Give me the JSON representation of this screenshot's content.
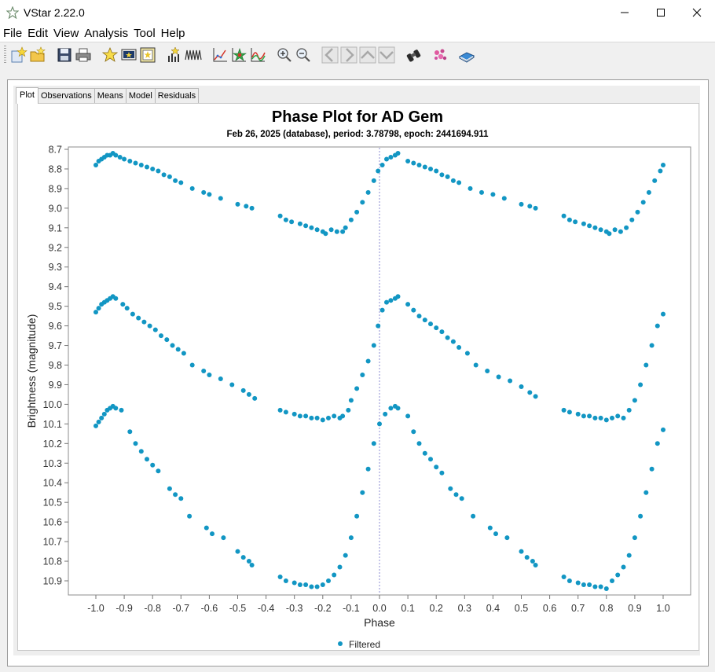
{
  "window": {
    "title": "VStar 2.22.0",
    "controls": [
      "minimize-icon",
      "maximize-icon",
      "close-icon"
    ]
  },
  "menu": {
    "items": [
      "File",
      "Edit",
      "View",
      "Analysis",
      "Tool",
      "Help"
    ]
  },
  "toolbar": {
    "icons": [
      "new-star-icon",
      "open-file-icon",
      "save-icon",
      "print-icon",
      "star-info-icon",
      "photometry-icon",
      "observation-details-icon",
      "period-analysis-icon",
      "wavelet-icon",
      "filter-plot-icon",
      "model-icon",
      "polynomial-fit-icon",
      "zoom-in-icon",
      "zoom-out-icon",
      "pan-left-icon",
      "pan-right-icon",
      "pan-up-icon",
      "pan-down-icon",
      "binoculars-icon",
      "plugin-icon",
      "help-book-icon"
    ]
  },
  "tabs": [
    {
      "label": "Plot",
      "active": true
    },
    {
      "label": "Observations",
      "active": false
    },
    {
      "label": "Means",
      "active": false
    },
    {
      "label": "Model",
      "active": false
    },
    {
      "label": "Residuals",
      "active": false
    }
  ],
  "colors": {
    "series": "#1296c3",
    "accent": "#0078d7"
  },
  "chart_data": {
    "type": "scatter",
    "title": "Phase Plot for AD Gem",
    "subtitle": "Feb 26, 2025 (database), period: 3.78798, epoch: 2441694.911",
    "xlabel": "Phase",
    "ylabel": "Brightness (magnitude)",
    "xlim": [
      -1.05,
      1.05
    ],
    "ylim": [
      8.7,
      10.95
    ],
    "y_inverted": true,
    "xticks": [
      "-1.0",
      "-0.9",
      "-0.8",
      "-0.7",
      "-0.6",
      "-0.5",
      "-0.4",
      "-0.3",
      "-0.2",
      "-0.1",
      "0.0",
      "0.1",
      "0.2",
      "0.3",
      "0.4",
      "0.5",
      "0.6",
      "0.7",
      "0.8",
      "0.9",
      "1.0"
    ],
    "yticks": [
      "8.7",
      "8.8",
      "8.9",
      "9.0",
      "9.1",
      "9.2",
      "9.3",
      "9.4",
      "9.5",
      "9.6",
      "9.7",
      "9.8",
      "9.9",
      "10.0",
      "10.1",
      "10.2",
      "10.3",
      "10.4",
      "10.5",
      "10.6",
      "10.7",
      "10.8",
      "10.9"
    ],
    "zero_line_x": 0.0,
    "legend": {
      "placement": "bottom-center",
      "entries": [
        "Filtered"
      ]
    },
    "series": [
      {
        "name": "Filtered",
        "points": [
          [
            -1.0,
            8.78
          ],
          [
            -0.99,
            8.76
          ],
          [
            -0.98,
            8.75
          ],
          [
            -0.97,
            8.74
          ],
          [
            -0.96,
            8.73
          ],
          [
            -0.95,
            8.73
          ],
          [
            -0.94,
            8.72
          ],
          [
            -0.93,
            8.73
          ],
          [
            -0.915,
            8.74
          ],
          [
            -0.9,
            8.75
          ],
          [
            -0.88,
            8.76
          ],
          [
            -0.86,
            8.77
          ],
          [
            -0.84,
            8.78
          ],
          [
            -0.82,
            8.79
          ],
          [
            -0.8,
            8.8
          ],
          [
            -0.78,
            8.81
          ],
          [
            -0.76,
            8.83
          ],
          [
            -0.74,
            8.84
          ],
          [
            -0.72,
            8.86
          ],
          [
            -0.7,
            8.87
          ],
          [
            -0.66,
            8.9
          ],
          [
            -0.62,
            8.92
          ],
          [
            -0.6,
            8.93
          ],
          [
            -0.56,
            8.95
          ],
          [
            -0.5,
            8.98
          ],
          [
            -0.47,
            8.99
          ],
          [
            -0.45,
            9.0
          ],
          [
            -0.35,
            9.04
          ],
          [
            -0.33,
            9.06
          ],
          [
            -0.31,
            9.07
          ],
          [
            -0.28,
            9.08
          ],
          [
            -0.26,
            9.09
          ],
          [
            -0.24,
            9.1
          ],
          [
            -0.22,
            9.11
          ],
          [
            -0.2,
            9.12
          ],
          [
            -0.19,
            9.13
          ],
          [
            -0.17,
            9.11
          ],
          [
            -0.15,
            9.12
          ],
          [
            -0.13,
            9.12
          ],
          [
            -0.12,
            9.1
          ],
          [
            -0.1,
            9.06
          ],
          [
            -0.08,
            9.02
          ],
          [
            -0.06,
            8.97
          ],
          [
            -0.04,
            8.92
          ],
          [
            -0.02,
            8.86
          ],
          [
            -0.005,
            8.81
          ],
          [
            0.01,
            8.78
          ],
          [
            0.025,
            8.75
          ],
          [
            0.04,
            8.74
          ],
          [
            0.055,
            8.73
          ],
          [
            0.065,
            8.72
          ],
          [
            0.1,
            8.76
          ],
          [
            0.12,
            8.77
          ],
          [
            0.14,
            8.78
          ],
          [
            0.16,
            8.79
          ],
          [
            0.18,
            8.8
          ],
          [
            0.2,
            8.81
          ],
          [
            0.22,
            8.83
          ],
          [
            0.24,
            8.84
          ],
          [
            0.26,
            8.86
          ],
          [
            0.28,
            8.87
          ],
          [
            0.32,
            8.9
          ],
          [
            0.36,
            8.92
          ],
          [
            0.4,
            8.93
          ],
          [
            0.44,
            8.95
          ],
          [
            0.5,
            8.98
          ],
          [
            0.53,
            8.99
          ],
          [
            0.55,
            9.0
          ],
          [
            0.65,
            9.04
          ],
          [
            0.67,
            9.06
          ],
          [
            0.69,
            9.07
          ],
          [
            0.72,
            9.08
          ],
          [
            0.74,
            9.09
          ],
          [
            0.76,
            9.1
          ],
          [
            0.78,
            9.11
          ],
          [
            0.8,
            9.12
          ],
          [
            0.81,
            9.13
          ],
          [
            0.83,
            9.11
          ],
          [
            0.85,
            9.12
          ],
          [
            0.87,
            9.1
          ],
          [
            0.89,
            9.06
          ],
          [
            0.91,
            9.02
          ],
          [
            0.93,
            8.97
          ],
          [
            0.95,
            8.92
          ],
          [
            0.97,
            8.86
          ],
          [
            0.99,
            8.81
          ],
          [
            1.0,
            8.78
          ],
          [
            -1.0,
            9.53
          ],
          [
            -0.99,
            9.51
          ],
          [
            -0.98,
            9.49
          ],
          [
            -0.97,
            9.48
          ],
          [
            -0.96,
            9.47
          ],
          [
            -0.95,
            9.46
          ],
          [
            -0.94,
            9.45
          ],
          [
            -0.93,
            9.46
          ],
          [
            -0.905,
            9.49
          ],
          [
            -0.89,
            9.51
          ],
          [
            -0.87,
            9.54
          ],
          [
            -0.85,
            9.56
          ],
          [
            -0.83,
            9.58
          ],
          [
            -0.81,
            9.6
          ],
          [
            -0.79,
            9.62
          ],
          [
            -0.77,
            9.65
          ],
          [
            -0.75,
            9.67
          ],
          [
            -0.73,
            9.7
          ],
          [
            -0.71,
            9.72
          ],
          [
            -0.69,
            9.74
          ],
          [
            -0.66,
            9.8
          ],
          [
            -0.62,
            9.83
          ],
          [
            -0.6,
            9.85
          ],
          [
            -0.56,
            9.87
          ],
          [
            -0.52,
            9.9
          ],
          [
            -0.48,
            9.93
          ],
          [
            -0.46,
            9.95
          ],
          [
            -0.44,
            9.97
          ],
          [
            -0.35,
            10.03
          ],
          [
            -0.33,
            10.04
          ],
          [
            -0.3,
            10.05
          ],
          [
            -0.28,
            10.06
          ],
          [
            -0.26,
            10.06
          ],
          [
            -0.24,
            10.07
          ],
          [
            -0.22,
            10.07
          ],
          [
            -0.2,
            10.08
          ],
          [
            -0.18,
            10.07
          ],
          [
            -0.16,
            10.06
          ],
          [
            -0.14,
            10.07
          ],
          [
            -0.13,
            10.06
          ],
          [
            -0.11,
            10.03
          ],
          [
            -0.1,
            9.98
          ],
          [
            -0.08,
            9.92
          ],
          [
            -0.06,
            9.85
          ],
          [
            -0.04,
            9.78
          ],
          [
            -0.02,
            9.7
          ],
          [
            -0.005,
            9.6
          ],
          [
            0.01,
            9.52
          ],
          [
            0.025,
            9.48
          ],
          [
            0.04,
            9.47
          ],
          [
            0.055,
            9.46
          ],
          [
            0.065,
            9.45
          ],
          [
            0.1,
            9.49
          ],
          [
            0.12,
            9.52
          ],
          [
            0.14,
            9.55
          ],
          [
            0.16,
            9.57
          ],
          [
            0.18,
            9.59
          ],
          [
            0.2,
            9.61
          ],
          [
            0.22,
            9.63
          ],
          [
            0.24,
            9.66
          ],
          [
            0.26,
            9.68
          ],
          [
            0.28,
            9.71
          ],
          [
            0.31,
            9.74
          ],
          [
            0.34,
            9.8
          ],
          [
            0.38,
            9.83
          ],
          [
            0.42,
            9.86
          ],
          [
            0.46,
            9.88
          ],
          [
            0.5,
            9.91
          ],
          [
            0.53,
            9.94
          ],
          [
            0.55,
            9.96
          ],
          [
            0.65,
            10.03
          ],
          [
            0.67,
            10.04
          ],
          [
            0.7,
            10.05
          ],
          [
            0.72,
            10.06
          ],
          [
            0.74,
            10.06
          ],
          [
            0.76,
            10.07
          ],
          [
            0.78,
            10.07
          ],
          [
            0.8,
            10.08
          ],
          [
            0.82,
            10.07
          ],
          [
            0.84,
            10.06
          ],
          [
            0.86,
            10.07
          ],
          [
            0.88,
            10.03
          ],
          [
            0.9,
            9.98
          ],
          [
            0.92,
            9.9
          ],
          [
            0.94,
            9.8
          ],
          [
            0.96,
            9.7
          ],
          [
            0.98,
            9.6
          ],
          [
            1.0,
            9.54
          ],
          [
            -1.0,
            10.11
          ],
          [
            -0.99,
            10.09
          ],
          [
            -0.98,
            10.07
          ],
          [
            -0.97,
            10.05
          ],
          [
            -0.96,
            10.03
          ],
          [
            -0.95,
            10.02
          ],
          [
            -0.94,
            10.01
          ],
          [
            -0.93,
            10.02
          ],
          [
            -0.91,
            10.03
          ],
          [
            -0.88,
            10.14
          ],
          [
            -0.86,
            10.2
          ],
          [
            -0.84,
            10.24
          ],
          [
            -0.82,
            10.28
          ],
          [
            -0.8,
            10.31
          ],
          [
            -0.78,
            10.34
          ],
          [
            -0.74,
            10.43
          ],
          [
            -0.72,
            10.46
          ],
          [
            -0.7,
            10.48
          ],
          [
            -0.67,
            10.57
          ],
          [
            -0.61,
            10.63
          ],
          [
            -0.59,
            10.66
          ],
          [
            -0.55,
            10.68
          ],
          [
            -0.5,
            10.75
          ],
          [
            -0.48,
            10.78
          ],
          [
            -0.46,
            10.8
          ],
          [
            -0.45,
            10.82
          ],
          [
            -0.35,
            10.88
          ],
          [
            -0.33,
            10.9
          ],
          [
            -0.3,
            10.91
          ],
          [
            -0.28,
            10.92
          ],
          [
            -0.26,
            10.92
          ],
          [
            -0.24,
            10.93
          ],
          [
            -0.22,
            10.93
          ],
          [
            -0.2,
            10.92
          ],
          [
            -0.18,
            10.9
          ],
          [
            -0.16,
            10.87
          ],
          [
            -0.14,
            10.83
          ],
          [
            -0.12,
            10.77
          ],
          [
            -0.1,
            10.68
          ],
          [
            -0.08,
            10.57
          ],
          [
            -0.06,
            10.45
          ],
          [
            -0.04,
            10.33
          ],
          [
            -0.02,
            10.2
          ],
          [
            0.0,
            10.1
          ],
          [
            0.02,
            10.05
          ],
          [
            0.04,
            10.02
          ],
          [
            0.055,
            10.01
          ],
          [
            0.065,
            10.02
          ],
          [
            0.1,
            10.06
          ],
          [
            0.12,
            10.14
          ],
          [
            0.14,
            10.2
          ],
          [
            0.16,
            10.25
          ],
          [
            0.18,
            10.28
          ],
          [
            0.2,
            10.32
          ],
          [
            0.22,
            10.35
          ],
          [
            0.25,
            10.43
          ],
          [
            0.27,
            10.46
          ],
          [
            0.29,
            10.48
          ],
          [
            0.33,
            10.57
          ],
          [
            0.39,
            10.63
          ],
          [
            0.41,
            10.66
          ],
          [
            0.45,
            10.68
          ],
          [
            0.5,
            10.75
          ],
          [
            0.52,
            10.78
          ],
          [
            0.54,
            10.8
          ],
          [
            0.55,
            10.82
          ],
          [
            0.65,
            10.88
          ],
          [
            0.67,
            10.9
          ],
          [
            0.7,
            10.91
          ],
          [
            0.72,
            10.92
          ],
          [
            0.74,
            10.92
          ],
          [
            0.76,
            10.93
          ],
          [
            0.78,
            10.93
          ],
          [
            0.8,
            10.94
          ],
          [
            0.82,
            10.9
          ],
          [
            0.84,
            10.87
          ],
          [
            0.86,
            10.83
          ],
          [
            0.88,
            10.77
          ],
          [
            0.9,
            10.68
          ],
          [
            0.92,
            10.57
          ],
          [
            0.94,
            10.45
          ],
          [
            0.96,
            10.33
          ],
          [
            0.98,
            10.2
          ],
          [
            1.0,
            10.13
          ]
        ]
      }
    ]
  }
}
